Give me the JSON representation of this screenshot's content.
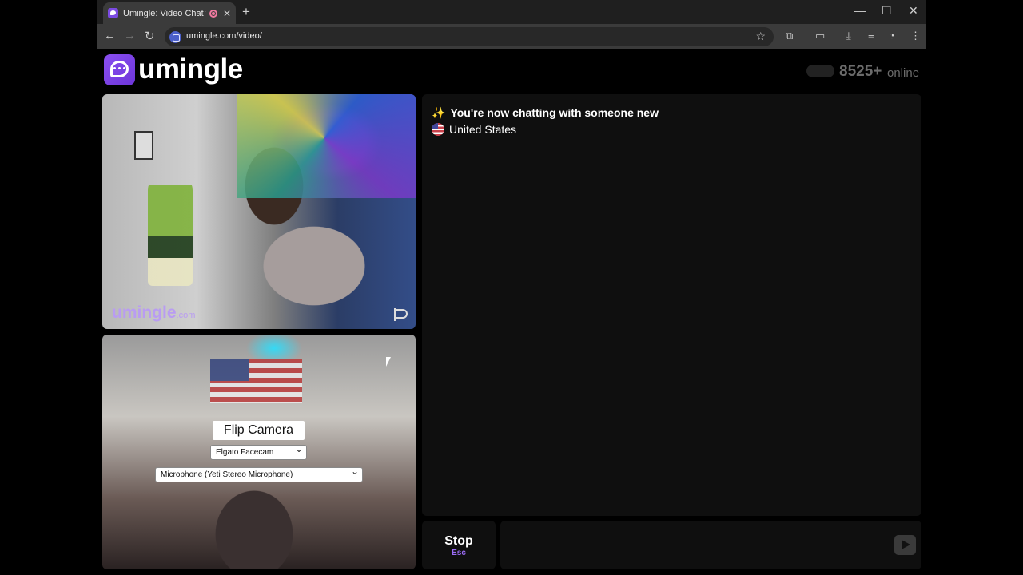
{
  "browser": {
    "tab": {
      "title": "Umingle: Video Chat with S",
      "close": "✕"
    },
    "new_tab": "+",
    "window_controls": {
      "minimize": "—",
      "maximize": "☐",
      "close": "✕"
    },
    "nav": {
      "back": "←",
      "forward": "→",
      "reload": "↻"
    },
    "url": "umingle.com/video/",
    "bookmark": "☆",
    "toolbar_icons": {
      "extensions": "⧉",
      "cast": "▭",
      "download": "⤓",
      "media": "≡",
      "account": "◔",
      "menu": "⋮"
    }
  },
  "site": {
    "logo_text": "umingle",
    "online_count": "8525+",
    "online_label": "online"
  },
  "stranger_video": {
    "watermark": "umingle",
    "watermark_suffix": ".com"
  },
  "self_video": {
    "flip_camera_label": "Flip Camera",
    "camera_select": "Elgato Facecam",
    "mic_select": "Microphone (Yeti Stereo Microphone)"
  },
  "chat": {
    "status_line": "You're now chatting with someone new",
    "country": "United States"
  },
  "controls": {
    "stop_label": "Stop",
    "stop_key": "Esc",
    "message_placeholder": ""
  }
}
